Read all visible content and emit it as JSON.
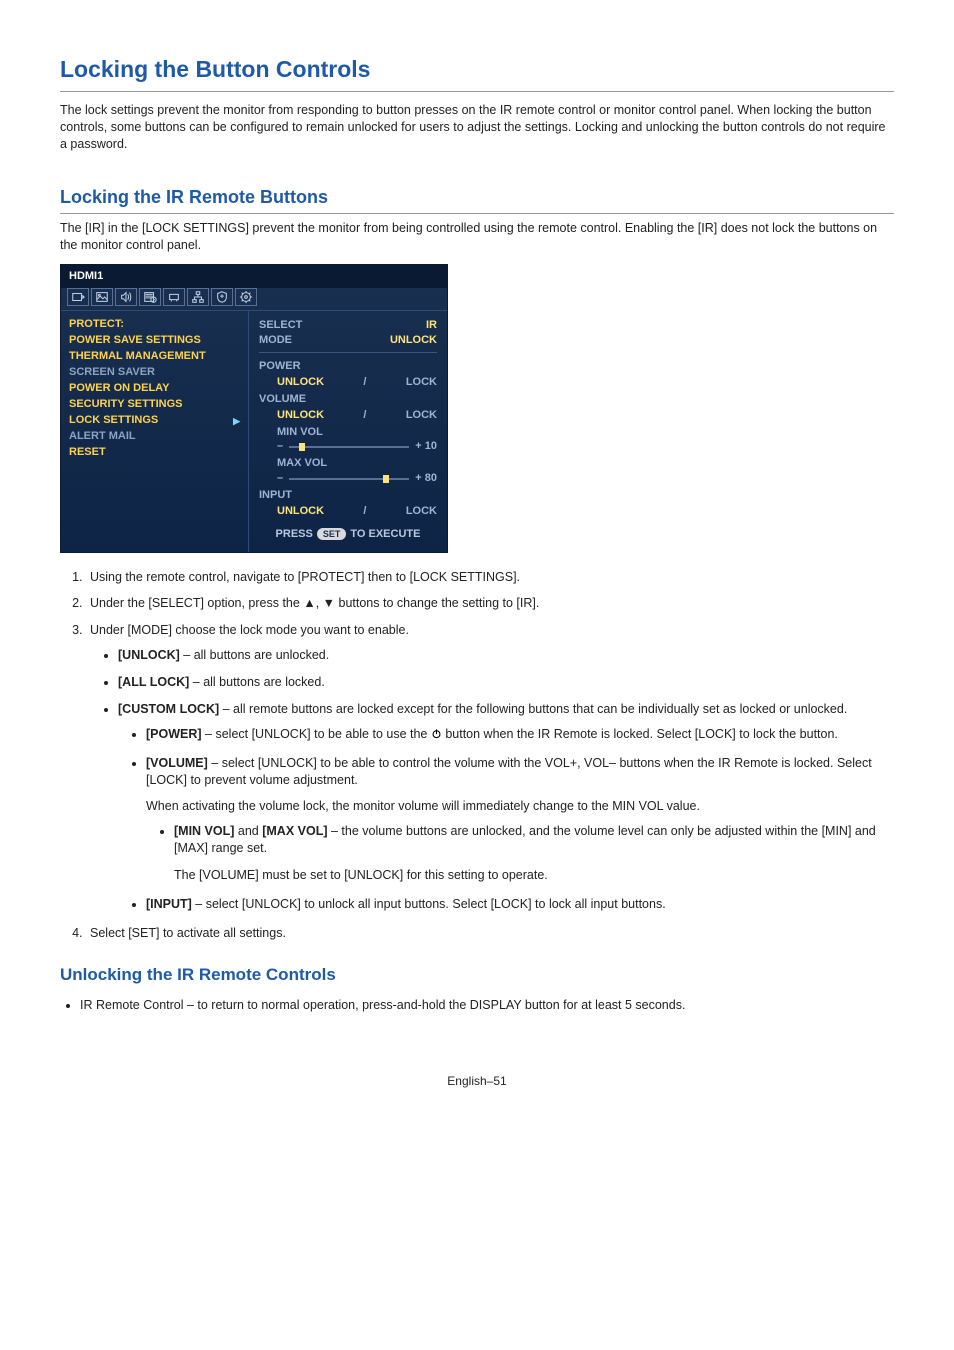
{
  "h1": "Locking the Button Controls",
  "intro": "The lock settings prevent the monitor from responding to button presses on the IR remote control or monitor control panel. When locking the button controls, some buttons can be configured to remain unlocked for users to adjust the settings. Locking and unlocking the button controls do not require a password.",
  "h2": "Locking the IR Remote Buttons",
  "p_ir": "The [IR] in the [LOCK SETTINGS] prevent the monitor from being controlled using the remote control. Enabling the [IR] does not lock the buttons on the monitor control panel.",
  "osd": {
    "source": "HDMI1",
    "left_header": "PROTECT:",
    "left_items": [
      "POWER SAVE SETTINGS",
      "THERMAL MANAGEMENT",
      "SCREEN SAVER",
      "POWER ON DELAY",
      "SECURITY SETTINGS",
      "LOCK SETTINGS",
      "ALERT MAIL",
      "RESET"
    ],
    "r_select_lbl": "SELECT",
    "r_select_val": "IR",
    "r_mode_lbl": "MODE",
    "r_mode_val": "UNLOCK",
    "r_power": "POWER",
    "r_volume": "VOLUME",
    "r_minvol": "MIN VOL",
    "r_maxvol": "MAX VOL",
    "r_input": "INPUT",
    "r_unlock": "UNLOCK",
    "r_lock": "LOCK",
    "r_slash": "/",
    "r_minus": "–",
    "r_plus10": "+  10",
    "r_plus80": "+  80",
    "r_press": "PRESS",
    "r_set": "SET",
    "r_exec": "TO EXECUTE",
    "slider_min_pct": 8,
    "slider_max_pct": 78
  },
  "steps": {
    "s1": "Using the remote control, navigate to [PROTECT] then to [LOCK SETTINGS].",
    "s2a": "Under the [SELECT] option, press the ",
    "s2b": " buttons to change the setting to [IR].",
    "s3": "Under [MODE] choose the lock mode you want to enable.",
    "unlock_b": "[UNLOCK]",
    "unlock_t": " – all buttons are unlocked.",
    "alllock_b": "[ALL LOCK]",
    "alllock_t": " – all buttons are locked.",
    "custom_b": "[CUSTOM LOCK]",
    "custom_t": " – all remote buttons are locked except for the following buttons that can be individually set as locked or unlocked.",
    "power_b": "[POWER]",
    "power_t1": " – select [UNLOCK] to be able to use the ",
    "power_t2": " button when the IR Remote is locked. Select [LOCK] to lock the button.",
    "volume_b": "[VOLUME]",
    "volume_t": " – select [UNLOCK] to be able to control the volume with the VOL+, VOL– buttons when the IR Remote is locked. Select [LOCK] to prevent volume adjustment.",
    "volume_note": "When activating the volume lock, the monitor volume will immediately change to the MIN VOL value.",
    "minmax_b1": "[MIN VOL]",
    "minmax_and": " and ",
    "minmax_b2": "[MAX VOL]",
    "minmax_t": " – the volume buttons are unlocked, and the volume level can only be adjusted within the [MIN] and [MAX] range set.",
    "minmax_note": "The [VOLUME] must be set to [UNLOCK] for this setting to operate.",
    "input_b": "[INPUT]",
    "input_t": " – select [UNLOCK] to unlock all input buttons. Select [LOCK] to lock all input buttons.",
    "s4": "Select [SET] to activate all settings."
  },
  "h3": "Unlocking the IR Remote Controls",
  "unlock_bullet": "IR Remote Control – to return to normal operation, press-and-hold the DISPLAY button for at least 5 seconds.",
  "footer": "English–51"
}
